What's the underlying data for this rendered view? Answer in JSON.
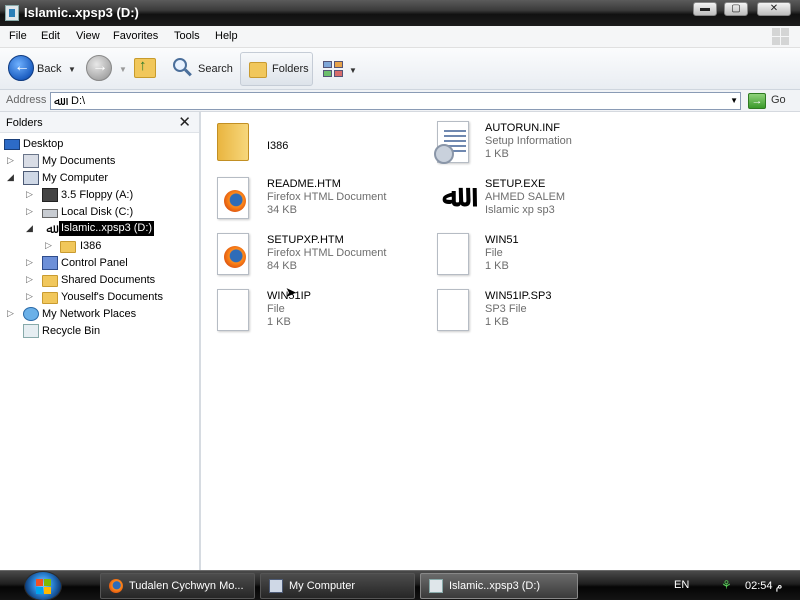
{
  "window": {
    "title": "Islamic..xpsp3 (D:)",
    "controls": {
      "minimize": "▬",
      "maximize": "▢",
      "close": "✕"
    }
  },
  "menu": [
    "File",
    "Edit",
    "View",
    "Favorites",
    "Tools",
    "Help"
  ],
  "toolbar": {
    "back_label": "Back",
    "search_label": "Search",
    "folders_label": "Folders"
  },
  "address": {
    "label": "Address",
    "value": "D:\\",
    "go_label": "Go"
  },
  "folders_pane": {
    "title": "Folders",
    "close": "✕",
    "tree": [
      {
        "label": "Desktop",
        "icon": "desktop-icon"
      },
      {
        "label": "My Documents",
        "icon": "documents-icon"
      },
      {
        "label": "My Computer",
        "icon": "computer-icon"
      },
      {
        "label": "3.5 Floppy (A:)",
        "icon": "floppy-icon"
      },
      {
        "label": "Local Disk (C:)",
        "icon": "disk-icon"
      },
      {
        "label": "Islamic..xpsp3 (D:)",
        "icon": "cd-drive-icon",
        "selected": true
      },
      {
        "label": "I386",
        "icon": "folder-icon"
      },
      {
        "label": "Control Panel",
        "icon": "control-panel-icon"
      },
      {
        "label": "Shared Documents",
        "icon": "folder-icon"
      },
      {
        "label": "Youself's Documents",
        "icon": "folder-icon"
      },
      {
        "label": "My Network Places",
        "icon": "network-icon"
      },
      {
        "label": "Recycle Bin",
        "icon": "recycle-bin-icon"
      }
    ]
  },
  "files": [
    {
      "name": "I386",
      "type": "",
      "size": "",
      "icon": "folder-icon"
    },
    {
      "name": "AUTORUN.INF",
      "type": "Setup Information",
      "size": "1 KB",
      "icon": "setup-info-icon"
    },
    {
      "name": "README.HTM",
      "type": "Firefox HTML Document",
      "size": "34 KB",
      "icon": "firefox-icon"
    },
    {
      "name": "SETUP.EXE",
      "type": "AHMED SALEM",
      "size": "Islamic xp sp3",
      "icon": "calligraphy-icon"
    },
    {
      "name": "SETUPXP.HTM",
      "type": "Firefox HTML Document",
      "size": "84 KB",
      "icon": "firefox-icon"
    },
    {
      "name": "WIN51",
      "type": "File",
      "size": "1 KB",
      "icon": "blank-file-icon"
    },
    {
      "name": "WIN51IP",
      "type": "File",
      "size": "1 KB",
      "icon": "blank-file-icon"
    },
    {
      "name": "WIN51IP.SP3",
      "type": "SP3 File",
      "size": "1 KB",
      "icon": "blank-file-icon"
    }
  ],
  "taskbar": {
    "tasks": [
      {
        "label": "Tudalen Cychwyn Mo...",
        "icon": "firefox-icon"
      },
      {
        "label": "My Computer",
        "icon": "computer-icon"
      },
      {
        "label": "Islamic..xpsp3 (D:)",
        "icon": "explorer-icon",
        "active": true
      }
    ],
    "language": "EN",
    "clock": "02:54 م"
  },
  "colors": {
    "selection": "#000000",
    "folder": "#f1c75b",
    "secondary_text": "#6d6d6d"
  }
}
